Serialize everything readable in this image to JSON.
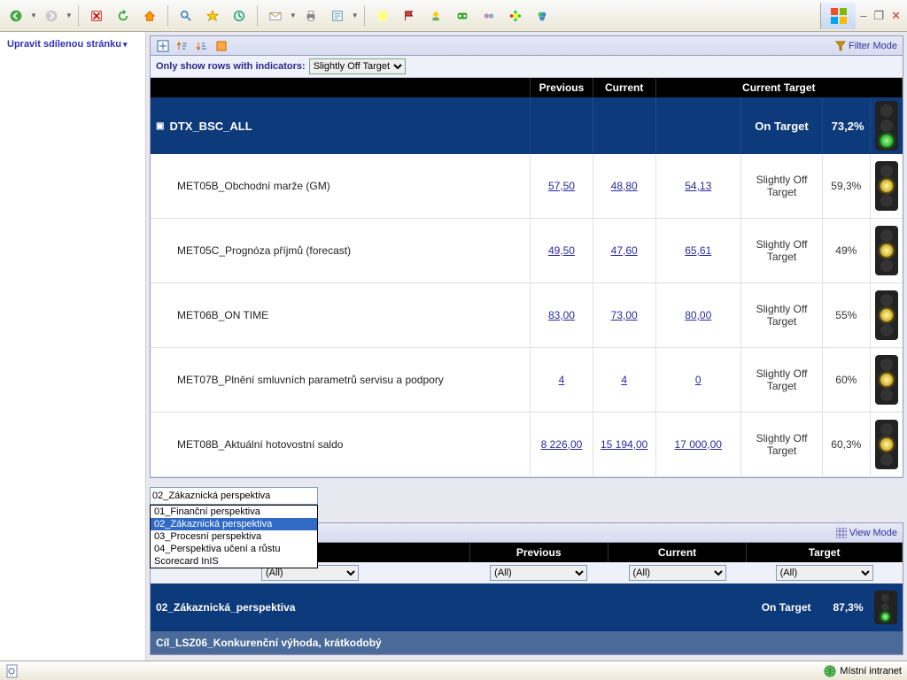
{
  "ie_toolbar": {
    "back": "back",
    "forward": "forward",
    "stop": "stop",
    "refresh": "refresh",
    "home": "home",
    "search": "search",
    "favorites": "favorites",
    "history": "history",
    "mail": "mail",
    "print": "print",
    "edit": "edit",
    "note": "note"
  },
  "left_link": "Upravit sdílenou stránku",
  "panel1": {
    "filter_mode": "Filter Mode",
    "filter_label": "Only show rows with indicators:",
    "filter_value": "Slightly Off Target",
    "headers": {
      "name": "",
      "previous": "Previous",
      "current": "Current",
      "target": "Current Target"
    },
    "group": {
      "name": "DTX_BSC_ALL",
      "status": "On Target",
      "pct": "73,2%",
      "light": "green"
    },
    "rows": [
      {
        "name": "MET05B_Obchodní marže (GM)",
        "previous": "57,50",
        "current": "48,80",
        "target": "54,13",
        "status": "Slightly Off Target",
        "pct": "59,3%",
        "light": "yellow"
      },
      {
        "name": "MET05C_Prognóza příjmů (forecast)",
        "previous": "49,50",
        "current": "47,60",
        "target": "65,61",
        "status": "Slightly Off Target",
        "pct": "49%",
        "light": "yellow"
      },
      {
        "name": "MET06B_ON TIME",
        "previous": "83,00",
        "current": "73,00",
        "target": "80,00",
        "status": "Slightly Off Target",
        "pct": "55%",
        "light": "yellow"
      },
      {
        "name": "MET07B_Plnění smluvních parametrů servisu a podpory",
        "previous": "4",
        "current": "4",
        "target": "0",
        "status": "Slightly Off Target",
        "pct": "60%",
        "light": "yellow"
      },
      {
        "name": "MET08B_Aktuální hotovostní saldo",
        "previous": "8 226,00",
        "current": "15 194,00",
        "target": "17 000,00",
        "status": "Slightly Off Target",
        "pct": "60,3%",
        "light": "yellow"
      }
    ]
  },
  "dd": {
    "selected": "02_Zákaznická perspektiva",
    "options": [
      "01_Finanční perspektiva",
      "02_Zákaznická perspektiva",
      "03_Procesní perspektiva",
      "04_Perspektiva učení a růstu",
      "Scorecard InIS"
    ]
  },
  "panel2": {
    "view_mode": "View Mode",
    "headers": {
      "previous": "Previous",
      "current": "Current",
      "target": "Target"
    },
    "all": "(All)",
    "group": {
      "name": "02_Zákaznická_perspektiva",
      "status": "On Target",
      "pct": "87,3%",
      "light": "green"
    },
    "sub": "Cíl_LSZ06_Konkurenční výhoda, krátkodobý"
  },
  "status_bar": {
    "zone": "Místní intranet"
  }
}
